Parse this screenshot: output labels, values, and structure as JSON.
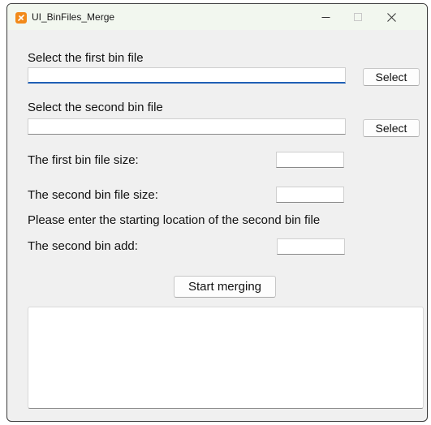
{
  "window": {
    "title": "UI_BinFiles_Merge",
    "icon": "app-logo-icon"
  },
  "first_file": {
    "label": "Select the first bin file",
    "value": "",
    "button_label": "Select"
  },
  "second_file": {
    "label": "Select the second bin file",
    "value": "",
    "button_label": "Select"
  },
  "sizes": {
    "first_label": "The first bin file size:",
    "first_value": "",
    "second_label": "The second bin file size:",
    "second_value": ""
  },
  "address": {
    "instruction": "Please enter the starting location of the second bin file",
    "label": "The second bin add:",
    "value": ""
  },
  "actions": {
    "merge_label": "Start merging"
  },
  "output": {
    "text": ""
  },
  "colors": {
    "focus_accent": "#1f5fb5",
    "titlebar": "#f2f7ef",
    "window_bg": "#f0f0f0",
    "icon_orange": "#f28a1a"
  }
}
